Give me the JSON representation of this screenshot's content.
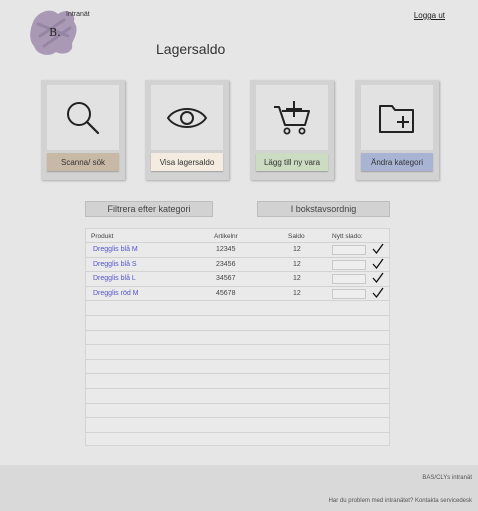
{
  "header": {
    "logo_letter": "B.",
    "intranet_label": "Intranät",
    "logout_label": "Logga ut",
    "page_title": "Lagersaldo"
  },
  "tiles": [
    {
      "label": "Scanna/ sök",
      "icon": "search-icon",
      "color": "#c8b9a6"
    },
    {
      "label": "Visa lagersaldo",
      "icon": "eye-icon",
      "color": "#f4ece0"
    },
    {
      "label": "Lägg till ny vara",
      "icon": "cart-plus-icon",
      "color": "#cbdcc2"
    },
    {
      "label": "Ändra kategori",
      "icon": "folder-plus-icon",
      "color": "#a9b4d4"
    }
  ],
  "filters": {
    "category_label": "Filtrera efter kategori",
    "alpha_label": "I bokstavsordnig"
  },
  "table": {
    "headers": {
      "product": "Produkt",
      "article": "Artikelnr",
      "balance": "Saldo",
      "new_balance": "Nytt slado:"
    },
    "rows": [
      {
        "product": "Dregglis blå M",
        "article": "12345",
        "balance": "12"
      },
      {
        "product": "Dregglis blå S",
        "article": "23456",
        "balance": "12"
      },
      {
        "product": "Dregglis blå L",
        "article": "34567",
        "balance": "12"
      },
      {
        "product": "Dregglis röd M",
        "article": "45678",
        "balance": "12"
      }
    ],
    "empty_row_count": 10
  },
  "footer": {
    "brand": "BAS/CLYs intranät",
    "help": "Har du problem med intranätet? Kontakta servicedesk"
  },
  "colors": {
    "link": "#5555cc",
    "logo_blob": "#a999b4"
  }
}
